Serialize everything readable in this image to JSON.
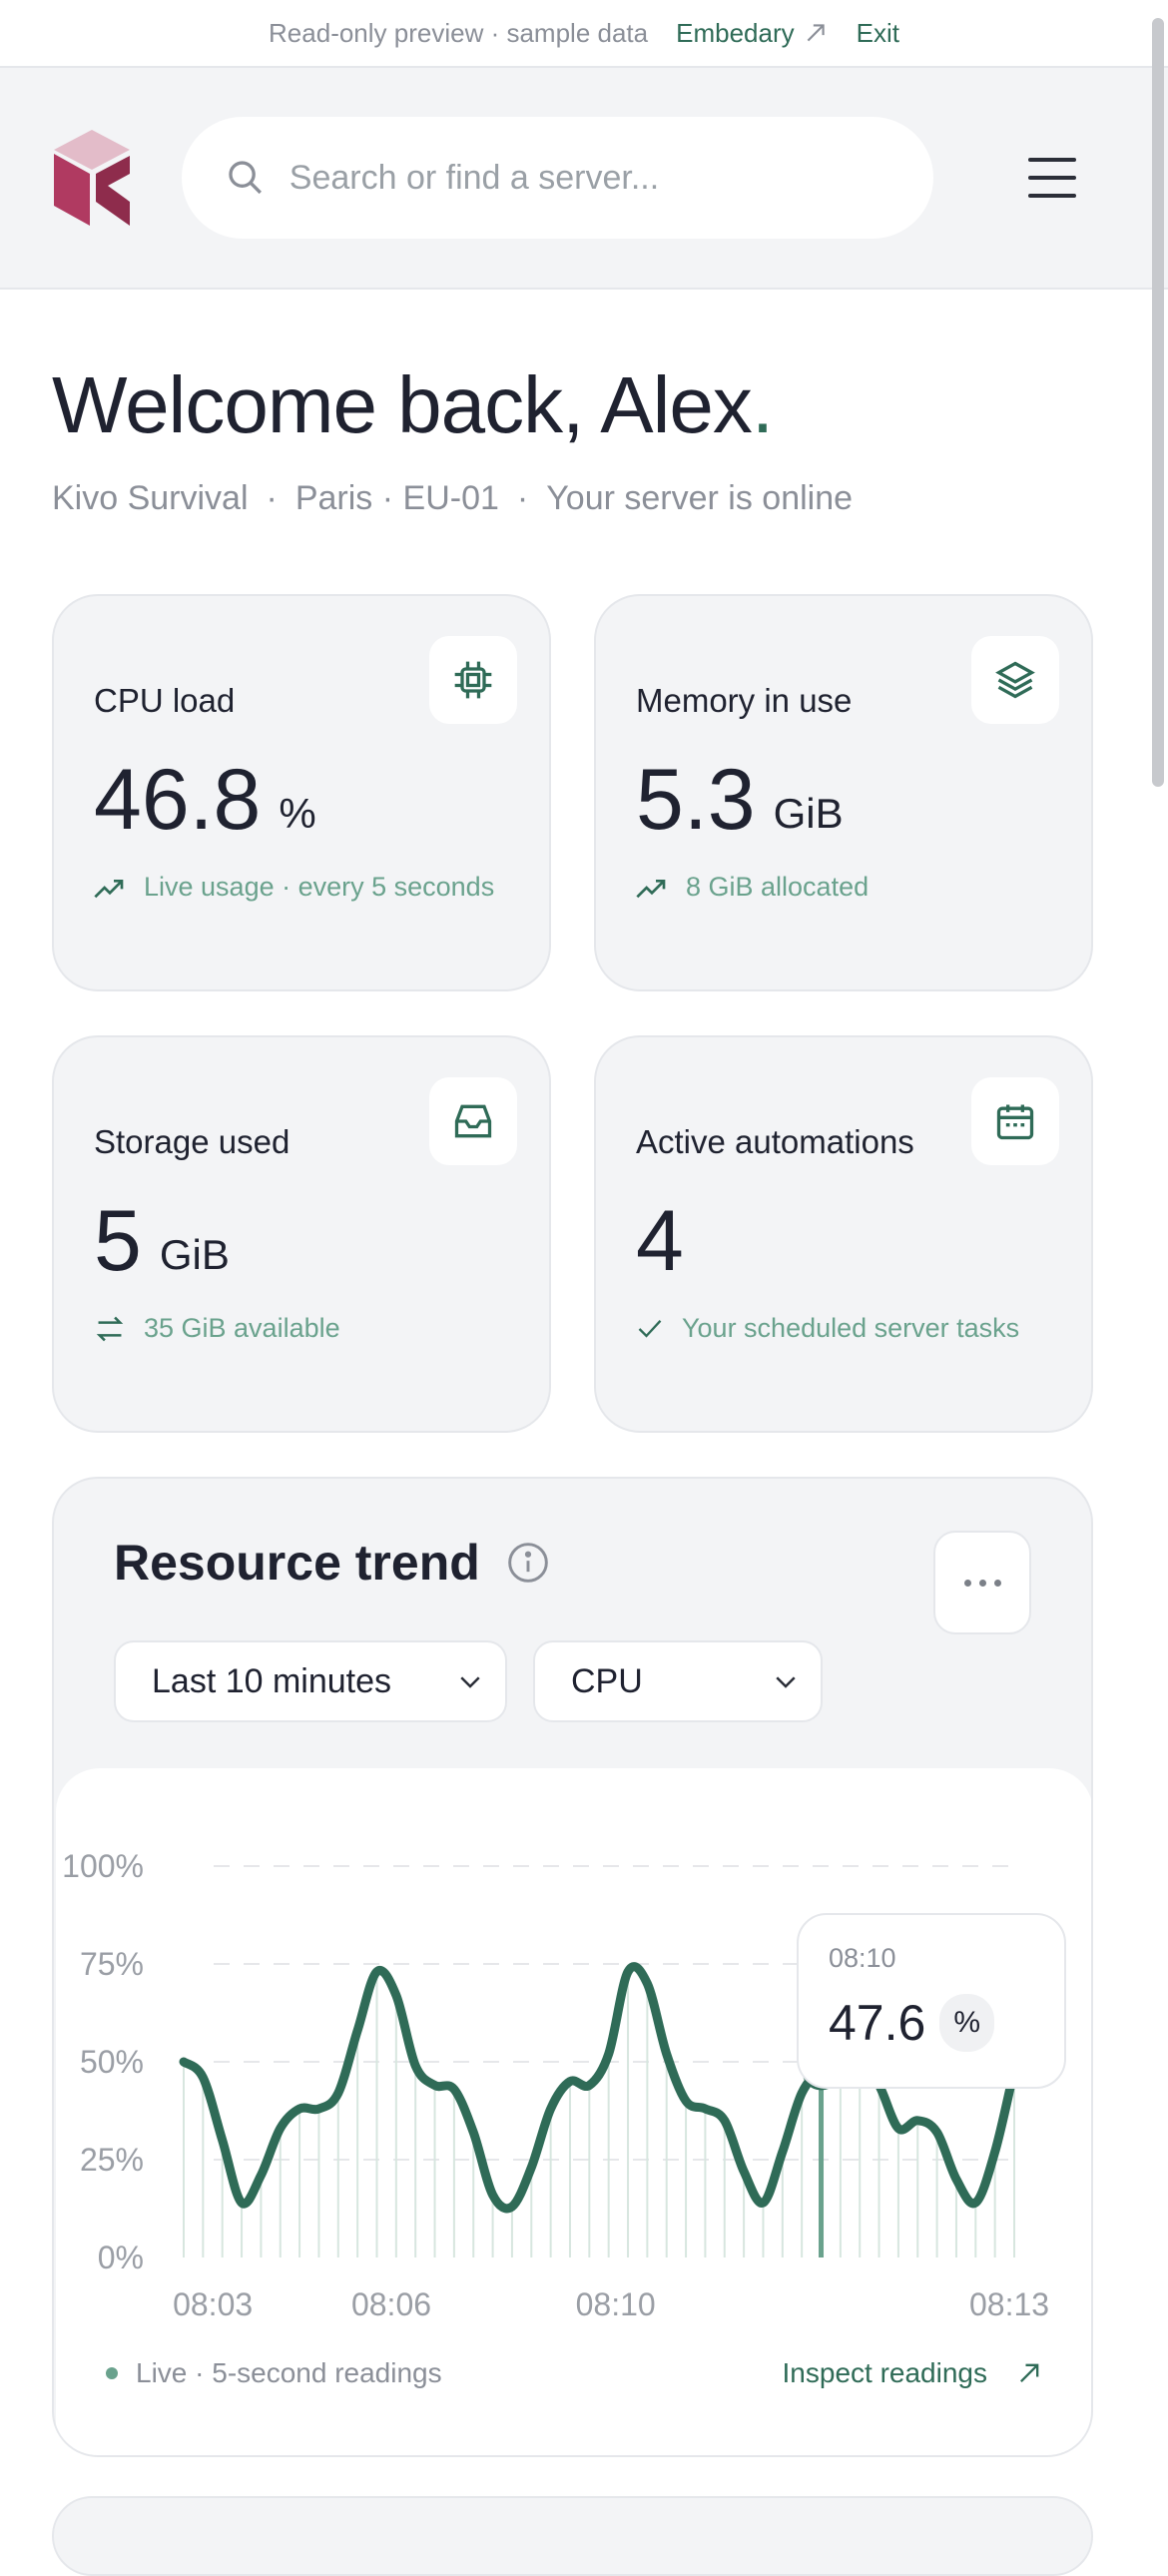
{
  "topbar": {
    "notice": "Read-only preview · sample data",
    "link_label": "Embedary",
    "exit_label": "Exit"
  },
  "header": {
    "search_placeholder": "Search or find a server..."
  },
  "welcome": {
    "title": "Welcome back, Alex",
    "title_dot": ".",
    "server_name": "Kivo Survival",
    "location": "Paris · EU-01",
    "status": "Your server is online"
  },
  "cards": [
    {
      "label": "CPU load",
      "value": "46.8",
      "unit": "%",
      "sub": "Live usage · every 5 seconds"
    },
    {
      "label": "Memory in use",
      "value": "5.3",
      "unit": "GiB",
      "sub": "8 GiB allocated"
    },
    {
      "label": "Storage used",
      "value": "5",
      "unit": "GiB",
      "sub": "35 GiB available"
    },
    {
      "label": "Active automations",
      "value": "4",
      "unit": "",
      "sub": "Your scheduled server tasks"
    }
  ],
  "trend": {
    "title": "Resource trend",
    "range_select": "Last 10 minutes",
    "metric_select": "CPU",
    "tooltip_time": "08:10",
    "tooltip_value": "47.6",
    "tooltip_unit": "%",
    "footer_live": "Live · 5-second readings",
    "footer_link": "Inspect readings"
  },
  "colors": {
    "accent": "#2f6b57",
    "logo_primary": "#b03a61",
    "logo_top": "#e3bcc9"
  },
  "chart_data": {
    "type": "line",
    "title": "",
    "xlabel": "",
    "ylabel": "",
    "ylim": [
      0,
      100
    ],
    "yticks": [
      "0%",
      "25%",
      "50%",
      "75%",
      "100%"
    ],
    "x_ticks": [
      "08:03",
      "08:06",
      "08:10",
      "08:13"
    ],
    "series": [
      {
        "values": [
          50,
          46,
          30,
          14,
          21,
          33,
          38,
          38,
          42,
          58,
          73,
          67,
          49,
          44,
          43,
          32,
          16,
          13,
          23,
          38,
          45,
          44,
          52,
          73,
          70,
          52,
          40,
          38,
          35,
          22,
          14,
          27,
          42,
          47.6,
          47.6,
          50,
          44,
          33,
          35,
          32,
          20,
          14,
          27,
          48
        ]
      }
    ],
    "highlight": {
      "label": "08:10",
      "value": 47.6
    }
  }
}
